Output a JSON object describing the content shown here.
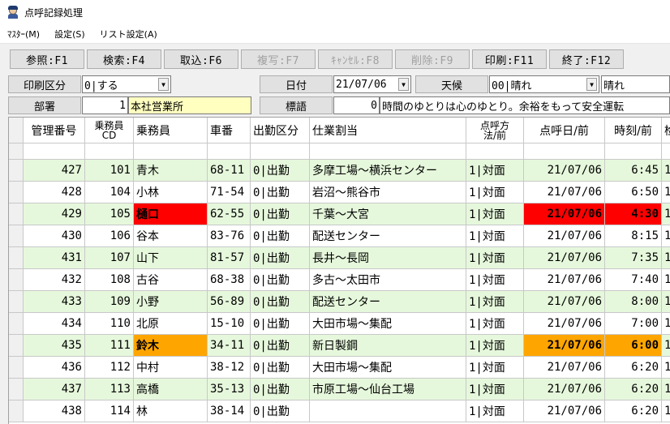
{
  "window": {
    "title": "点呼記録処理",
    "icon": "driver-icon"
  },
  "menu": [
    "ﾏｽﾀｰ(M)",
    "設定(S)",
    "リスト設定(A)"
  ],
  "toolbar": [
    {
      "label": "参照:F1",
      "enabled": true
    },
    {
      "label": "検索:F4",
      "enabled": true
    },
    {
      "label": "取込:F6",
      "enabled": true
    },
    {
      "label": "複写:F7",
      "enabled": false
    },
    {
      "label": "ｷｬﾝｾﾙ:F8",
      "enabled": false
    },
    {
      "label": "削除:F9",
      "enabled": false
    },
    {
      "label": "印刷:F11",
      "enabled": true
    },
    {
      "label": "終了:F12",
      "enabled": true
    }
  ],
  "form": {
    "print_label": "印刷区分",
    "print_value": "0|する",
    "date_label": "日付",
    "date_value": "21/07/06",
    "weather_label": "天候",
    "weather_value": "00|晴れ",
    "weather_text": "晴れ",
    "dept_label": "部署",
    "dept_code": "1",
    "dept_name": "本社営業所",
    "motto_label": "標語",
    "motto_code": "0",
    "motto_text": "時間のゆとりは心のゆとり。余裕をもって安全運転"
  },
  "table": {
    "headers": [
      "管理番号",
      "乗務員CD",
      "乗務員",
      "車番",
      "出勤区分",
      "仕業割当",
      "点呼方法/前",
      "点呼日/前",
      "時刻/前",
      "检"
    ],
    "header_two_line": {
      "col1": [
        "乗務員",
        "CD"
      ],
      "col6": [
        "点呼方",
        "法/前"
      ]
    },
    "rows": [
      {
        "no": "427",
        "cd": "101",
        "name": "青木",
        "car": "68-11",
        "kubun": "0|出勤",
        "task": "多摩工場～横浜センター",
        "method": "1|対面",
        "date": "21/07/06",
        "time": "6:45",
        "extra": "1",
        "highlight": ""
      },
      {
        "no": "428",
        "cd": "104",
        "name": "小林",
        "car": "71-54",
        "kubun": "0|出勤",
        "task": "岩沼～熊谷市",
        "method": "1|対面",
        "date": "21/07/06",
        "time": "6:50",
        "extra": "1",
        "highlight": ""
      },
      {
        "no": "429",
        "cd": "105",
        "name": "樋口",
        "car": "62-55",
        "kubun": "0|出勤",
        "task": "千葉～大宮",
        "method": "1|対面",
        "date": "21/07/06",
        "time": "4:30",
        "extra": "1",
        "highlight": "red"
      },
      {
        "no": "430",
        "cd": "106",
        "name": "谷本",
        "car": "83-76",
        "kubun": "0|出勤",
        "task": "配送センター",
        "method": "1|対面",
        "date": "21/07/06",
        "time": "8:15",
        "extra": "1",
        "highlight": ""
      },
      {
        "no": "431",
        "cd": "107",
        "name": "山下",
        "car": "81-57",
        "kubun": "0|出勤",
        "task": "長井～長岡",
        "method": "1|対面",
        "date": "21/07/06",
        "time": "7:35",
        "extra": "1",
        "highlight": ""
      },
      {
        "no": "432",
        "cd": "108",
        "name": "古谷",
        "car": "68-38",
        "kubun": "0|出勤",
        "task": "多古～太田市",
        "method": "1|対面",
        "date": "21/07/06",
        "time": "7:40",
        "extra": "1",
        "highlight": ""
      },
      {
        "no": "433",
        "cd": "109",
        "name": "小野",
        "car": "56-89",
        "kubun": "0|出勤",
        "task": "配送センター",
        "method": "1|対面",
        "date": "21/07/06",
        "time": "8:00",
        "extra": "1",
        "highlight": ""
      },
      {
        "no": "434",
        "cd": "110",
        "name": "北原",
        "car": "15-10",
        "kubun": "0|出勤",
        "task": "大田市場～集配",
        "method": "1|対面",
        "date": "21/07/06",
        "time": "7:00",
        "extra": "1",
        "highlight": ""
      },
      {
        "no": "435",
        "cd": "111",
        "name": "鈴木",
        "car": "34-11",
        "kubun": "0|出勤",
        "task": "新日製鋼",
        "method": "1|対面",
        "date": "21/07/06",
        "time": "6:00",
        "extra": "1",
        "highlight": "orange"
      },
      {
        "no": "436",
        "cd": "112",
        "name": "中村",
        "car": "38-12",
        "kubun": "0|出勤",
        "task": "大田市場～集配",
        "method": "1|対面",
        "date": "21/07/06",
        "time": "6:20",
        "extra": "1",
        "highlight": ""
      },
      {
        "no": "437",
        "cd": "113",
        "name": "高橋",
        "car": "35-13",
        "kubun": "0|出勤",
        "task": "市原工場～仙台工場",
        "method": "1|対面",
        "date": "21/07/06",
        "time": "6:20",
        "extra": "1",
        "highlight": ""
      },
      {
        "no": "438",
        "cd": "114",
        "name": "林",
        "car": "38-14",
        "kubun": "0|出勤",
        "task": "",
        "method": "1|対面",
        "date": "21/07/06",
        "time": "6:20",
        "extra": "1",
        "highlight": ""
      }
    ]
  },
  "colors": {
    "row_alt": "#e6f8dc",
    "alert_red": "#ff0000",
    "alert_orange": "#ffa500"
  }
}
